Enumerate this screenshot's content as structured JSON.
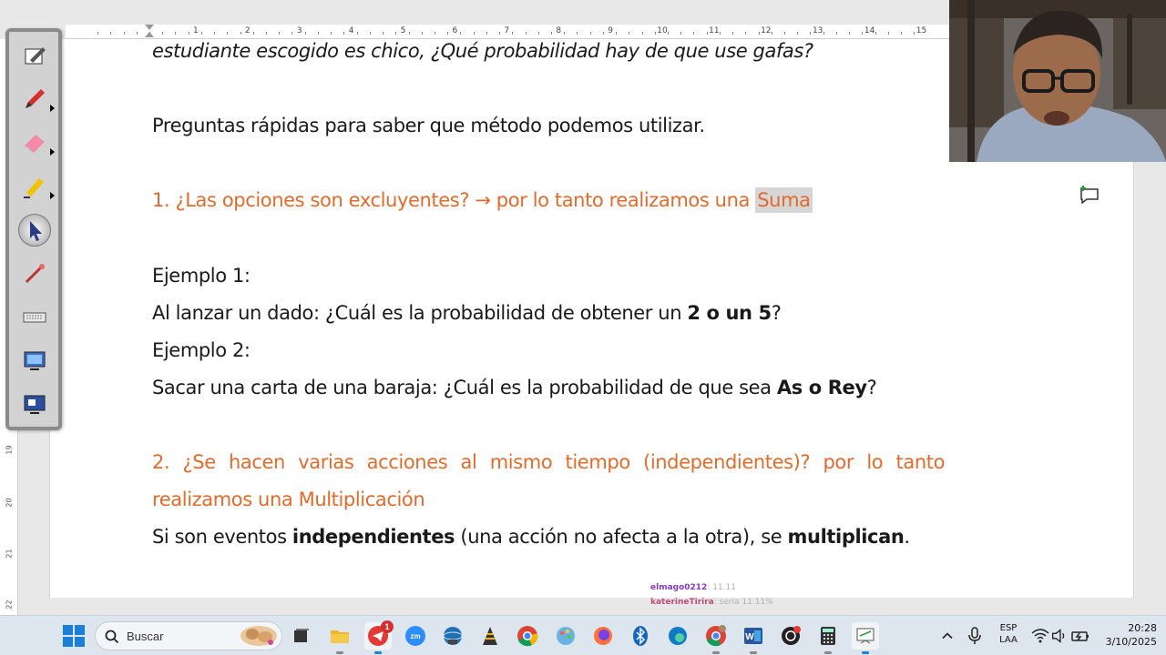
{
  "document": {
    "line1": "estudiante escogido es chico, ¿Qué probabilidad hay de que use gafas?",
    "line2": "Preguntas rápidas para saber que método podemos utilizar.",
    "q1_text": "1. ¿Las opciones son excluyentes? → por lo tanto realizamos una ",
    "q1_highlight": "Suma",
    "ex1_title": "Ejemplo 1:",
    "ex1_text_a": " Al lanzar un dado: ¿Cuál es la probabilidad de obtener un ",
    "ex1_bold": "2 o un 5",
    "ex1_text_b": "?",
    "ex2_title": "Ejemplo 2:",
    "ex2_text_a": "Sacar una carta de una baraja: ¿Cuál es la probabilidad de que sea ",
    "ex2_bold": "As o Rey",
    "ex2_text_b": "?",
    "q2_line1": "2. ¿Se hacen varias acciones al mismo tiempo (independientes)? por lo tanto",
    "q2_line2": "realizamos una Multiplicación",
    "ind_a": "Si son eventos ",
    "ind_bold1": "independientes",
    "ind_b": " (una acción no afecta a la otra), se ",
    "ind_bold2": "multiplican",
    "ind_c": "."
  },
  "ruler": {
    "h_numbers": [
      "1",
      "2",
      "3",
      "4",
      "5",
      "6",
      "7",
      "8",
      "9",
      "10",
      "11",
      "12",
      "13",
      "14",
      "15"
    ],
    "v_numbers": [
      "19",
      "20",
      "21",
      "22"
    ]
  },
  "chat": {
    "user1": "elmago0212",
    "msg1": ": 11.11",
    "user2": "katerineTirira",
    "msg2": ": sería 11.11%"
  },
  "taskbar": {
    "search_placeholder": "Buscar",
    "telegram_badge": "1",
    "lang": "ESP",
    "layout": "LAA",
    "time": "20:28",
    "date": "3/10/2025"
  },
  "colors": {
    "accent_orange": "#e26b2c",
    "highlight_gray": "#d6d6d6"
  }
}
